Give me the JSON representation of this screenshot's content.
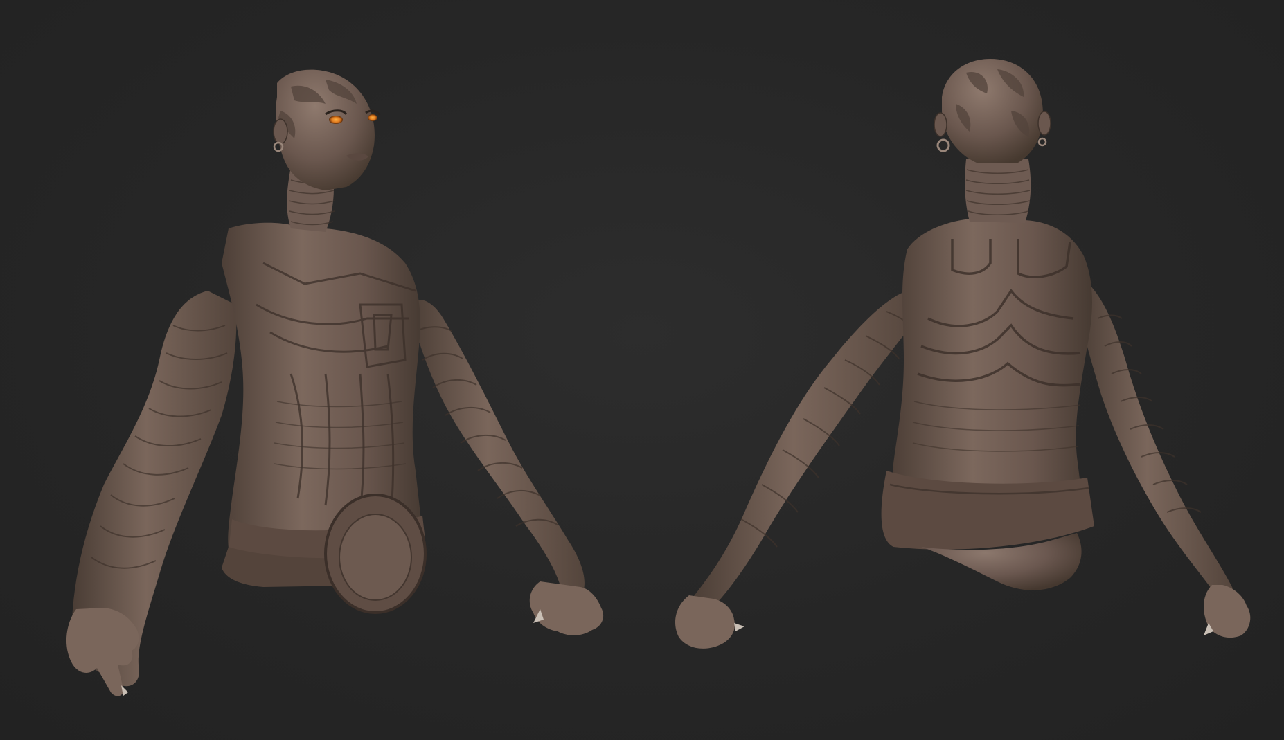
{
  "scene": {
    "background_color": "#262626",
    "material_color": "#6e5b52",
    "material_highlight": "#8a766b",
    "material_shadow": "#3f332d",
    "eye_color": "#e07a1e",
    "views": [
      {
        "name": "front-three-quarter-view"
      },
      {
        "name": "back-view"
      }
    ]
  }
}
